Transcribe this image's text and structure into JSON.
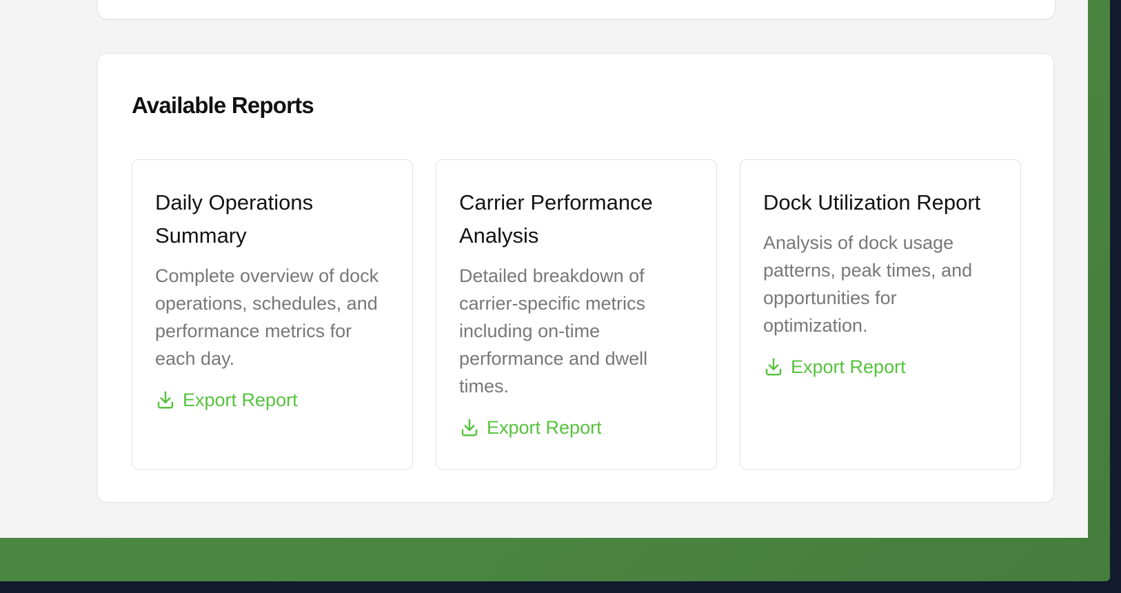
{
  "reports_section": {
    "title": "Available Reports",
    "cards": [
      {
        "title": "Daily Operations Summary",
        "description": "Complete overview of dock operations, schedules, and performance metrics for each day.",
        "action_label": "Export Report",
        "action_icon": "download-icon"
      },
      {
        "title": "Carrier Performance Analysis",
        "description": "Detailed breakdown of carrier-specific metrics including on-time performance and dwell times.",
        "action_label": "Export Report",
        "action_icon": "download-icon"
      },
      {
        "title": "Dock Utilization Report",
        "description": "Analysis of dock usage patterns, peak times, and opportunities for optimization.",
        "action_label": "Export Report",
        "action_icon": "download-icon"
      }
    ]
  },
  "colors": {
    "accent": "#56c23d",
    "frame_green": "#4a8a42",
    "page_background": "#f4f4f4",
    "outer_background": "#121a2e",
    "card_border": "#e2e2e2",
    "title_text": "#111111",
    "description_text": "#777777"
  }
}
